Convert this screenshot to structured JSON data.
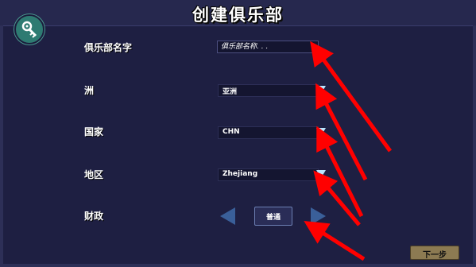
{
  "header": {
    "title": "创建俱乐部"
  },
  "toolbar": {
    "icon": "wrench-key-icon",
    "accent": "#2e7b72"
  },
  "form": {
    "club_name": {
      "label": "俱乐部名字",
      "placeholder": "俱乐部名称. . ."
    },
    "continent": {
      "label": "洲",
      "value": "亚洲"
    },
    "country": {
      "label": "国家",
      "value": "CHN"
    },
    "region": {
      "label": "地区",
      "value": "Zhejiang"
    },
    "finance": {
      "label": "财政",
      "value": "普通"
    }
  },
  "footer": {
    "next_label": "下一步"
  },
  "colors": {
    "background": "#1e1f42",
    "arrow": "#ff0000",
    "dropdown_arrow": "#b8e6ff",
    "next_button": "#8c7a52"
  }
}
